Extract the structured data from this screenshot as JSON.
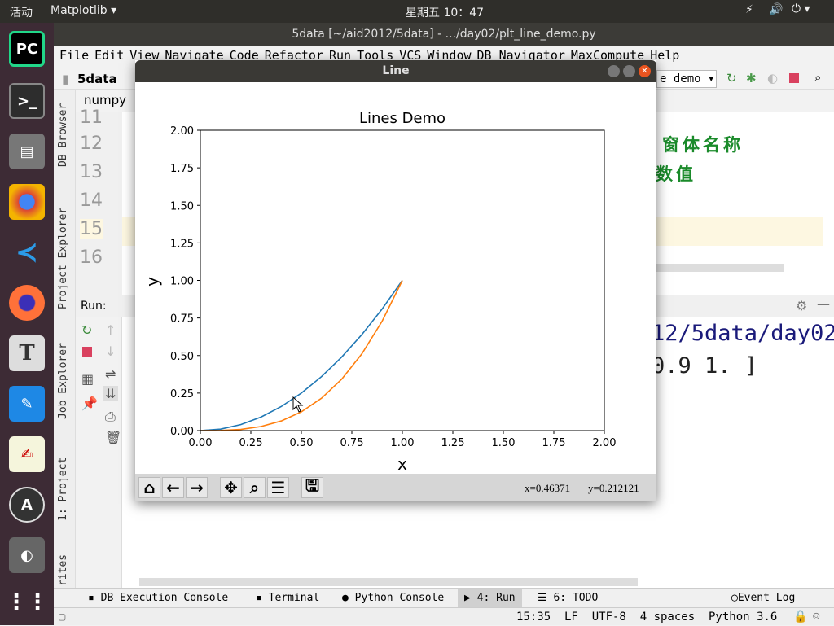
{
  "topbar": {
    "activities": "活动",
    "app": "Matplotlib",
    "clock": "星期五 10：47"
  },
  "ide": {
    "title": "5data [~/aid2012/5data] - .../day02/plt_line_demo.py",
    "menu": [
      "File",
      "Edit",
      "View",
      "Navigate",
      "Code",
      "Refactor",
      "Run",
      "Tools",
      "VCS",
      "Window",
      "DB Navigator",
      "MaxCompute",
      "Help"
    ],
    "breadcrumb": "5data",
    "run_config": "e_demo",
    "left_tools": [
      "DB Browser",
      "Project Explorer",
      "Job Explorer",
      "1: Project",
      "rites"
    ],
    "editor_tab": "numpy",
    "line_numbers": [
      "11",
      "12",
      "13",
      "14",
      "15",
      "16"
    ],
    "comment1": "窗体名称",
    "comment2": "数值",
    "run_label": "Run:",
    "console_line1": "12/5data/day02",
    "console_line2": "0.9 1. ]",
    "bottom_tabs": [
      "DB Execution Console",
      "Terminal",
      "Python Console",
      "4: Run",
      "6: TODO"
    ],
    "event_log": "Event Log",
    "status": "15:35  LF  UTF-8  4 spaces  Python 3.6"
  },
  "mpl_window": {
    "title": "Line",
    "coords_x": "x=0.46371",
    "coords_y": "y=0.212121",
    "toolbar": [
      "home-icon",
      "back-icon",
      "forward-icon",
      "pan-icon",
      "zoom-icon",
      "configure-icon",
      "save-icon"
    ]
  },
  "chart_data": {
    "type": "line",
    "title": "Lines Demo",
    "xlabel": "x",
    "ylabel": "y",
    "xlim": [
      0,
      2
    ],
    "ylim": [
      0,
      2
    ],
    "xticks": [
      "0.00",
      "0.25",
      "0.50",
      "0.75",
      "1.00",
      "1.25",
      "1.50",
      "1.75",
      "2.00"
    ],
    "yticks": [
      "0.00",
      "0.25",
      "0.50",
      "0.75",
      "1.00",
      "1.25",
      "1.50",
      "1.75",
      "2.00"
    ],
    "x": [
      0,
      0.1,
      0.2,
      0.3,
      0.4,
      0.5,
      0.6,
      0.7,
      0.8,
      0.9,
      1.0
    ],
    "series": [
      {
        "color": "#1f77b4",
        "values": [
          0,
          0.01,
          0.04,
          0.09,
          0.16,
          0.25,
          0.36,
          0.49,
          0.64,
          0.81,
          1.0
        ]
      },
      {
        "color": "#ff7f0e",
        "values": [
          0,
          0.001,
          0.008,
          0.027,
          0.064,
          0.125,
          0.216,
          0.343,
          0.512,
          0.729,
          1.0
        ]
      }
    ],
    "grid": false
  }
}
